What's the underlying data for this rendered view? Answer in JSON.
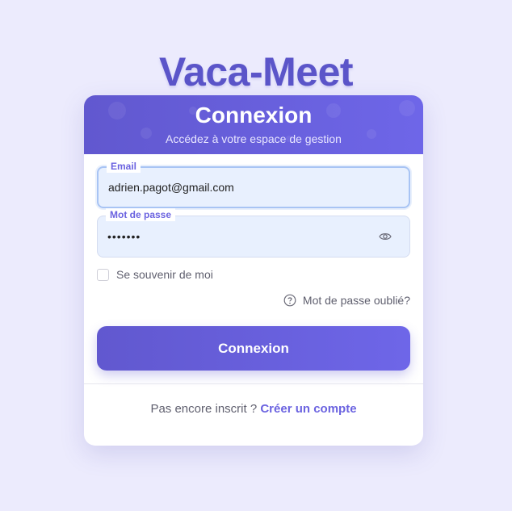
{
  "app": {
    "title": "Vaca-Meet"
  },
  "card": {
    "title": "Connexion",
    "subtitle": "Accédez à votre espace de gestion"
  },
  "form": {
    "email": {
      "label": "Email",
      "value": "adrien.pagot@gmail.com"
    },
    "password": {
      "label": "Mot de passe",
      "value": "•••••••",
      "toggle_icon": "eye-icon"
    },
    "remember": {
      "label": "Se souvenir de moi",
      "checked": false
    },
    "forgot": {
      "label": "Mot de passe oublié?",
      "icon": "help-circle-icon"
    },
    "submit_label": "Connexion"
  },
  "footer": {
    "prompt": "Pas encore inscrit ?",
    "link": "Créer un compte"
  },
  "colors": {
    "background": "#ecebfd",
    "brand": "#5b55c9",
    "accent": "#6b63e0",
    "input_fill": "#e8f0fe"
  }
}
